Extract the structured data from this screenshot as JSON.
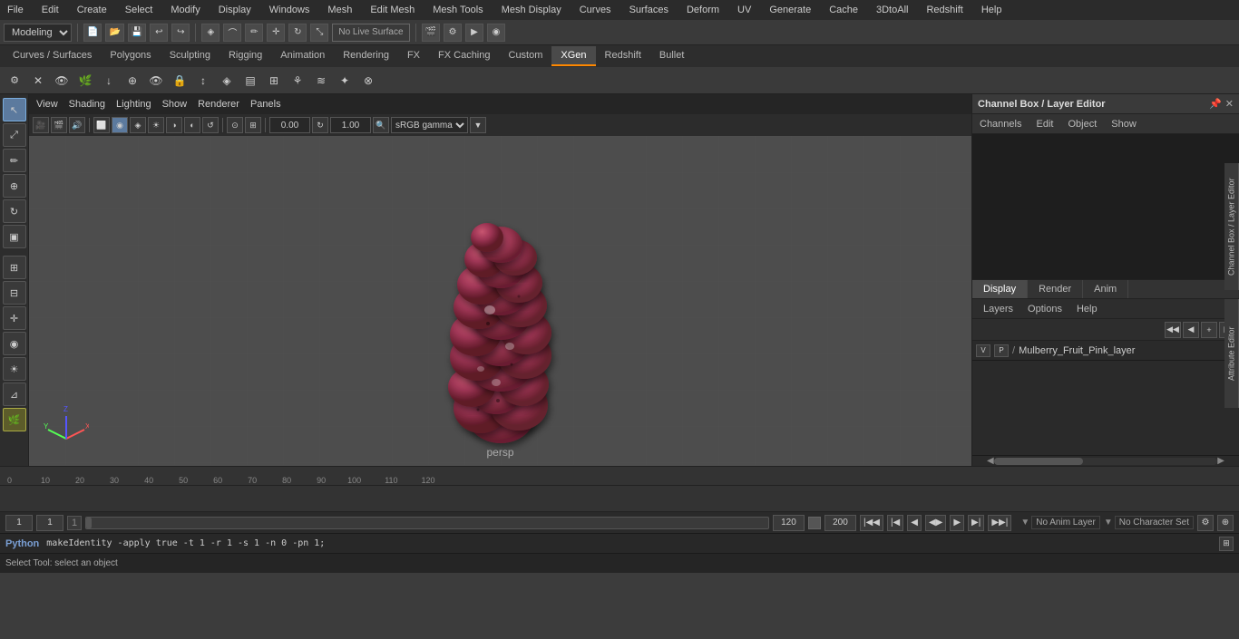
{
  "menubar": {
    "items": [
      "File",
      "Edit",
      "Create",
      "Select",
      "Modify",
      "Display",
      "Windows",
      "Mesh",
      "Edit Mesh",
      "Mesh Tools",
      "Mesh Display",
      "Curves",
      "Surfaces",
      "Deform",
      "UV",
      "Generate",
      "Cache",
      "3DtoAll",
      "Redshift",
      "Help"
    ]
  },
  "toolbar1": {
    "workspace_label": "Modeling",
    "live_surface": "No Live Surface"
  },
  "tabs": {
    "items": [
      "Curves / Surfaces",
      "Polygons",
      "Sculpting",
      "Rigging",
      "Animation",
      "Rendering",
      "FX",
      "FX Caching",
      "Custom",
      "XGen",
      "Redshift",
      "Bullet"
    ],
    "active": "XGen"
  },
  "viewport": {
    "menus": [
      "View",
      "Shading",
      "Lighting",
      "Show",
      "Renderer",
      "Panels"
    ],
    "persp_label": "persp",
    "rotation_value": "0.00",
    "zoom_value": "1.00",
    "color_space": "sRGB gamma"
  },
  "left_toolbar": {
    "tools": [
      "▶",
      "↔",
      "✎",
      "⊕",
      "↻",
      "▣",
      "⊞",
      "⊟",
      "▼"
    ]
  },
  "channel_box": {
    "title": "Channel Box / Layer Editor",
    "menus": [
      "Channels",
      "Edit",
      "Object",
      "Show"
    ]
  },
  "layer_editor": {
    "tabs": [
      "Display",
      "Render",
      "Anim"
    ],
    "active_tab": "Display",
    "options": [
      "Layers",
      "Options",
      "Help"
    ],
    "layers": [
      {
        "v": "V",
        "p": "P",
        "name": "Mulberry_Fruit_Pink_layer"
      }
    ]
  },
  "timeline": {
    "marks": [
      "0",
      "10",
      "20",
      "30",
      "40",
      "50",
      "60",
      "70",
      "80",
      "90",
      "100",
      "110",
      "120"
    ],
    "start": "1",
    "end": "120",
    "playback_end": "200"
  },
  "bottom_bar": {
    "frame_current_1": "1",
    "frame_current_2": "1",
    "progress_val": "120",
    "anim_end": "120",
    "playback_end": "200",
    "no_anim_layer": "No Anim Layer",
    "no_char_set": "No Character Set"
  },
  "python_bar": {
    "label": "Python",
    "command": "makeIdentity -apply true -t 1 -r 1 -s 1 -n 0 -pn 1;"
  },
  "status_bar": {
    "message": "Select Tool: select an object"
  },
  "side_labels": {
    "channel_box": "Channel Box / Layer Editor",
    "attr_editor": "Attribute Editor"
  }
}
